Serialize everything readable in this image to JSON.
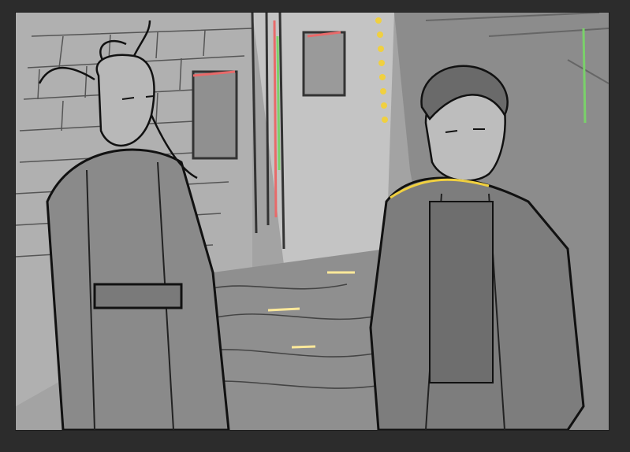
{
  "app": {
    "background_color": "#2c2c2c",
    "canvas_background": "#9a9a9a"
  },
  "artwork": {
    "style": "grayscale rough sketch with neon color accents",
    "accent_colors": [
      "#f0d040",
      "#e86a6a",
      "#7ad16a",
      "#ffe99a"
    ],
    "icon": "image-icon",
    "subjects": [
      "long-haired-figure",
      "jacket-figure"
    ],
    "setting": "narrow-alley"
  }
}
